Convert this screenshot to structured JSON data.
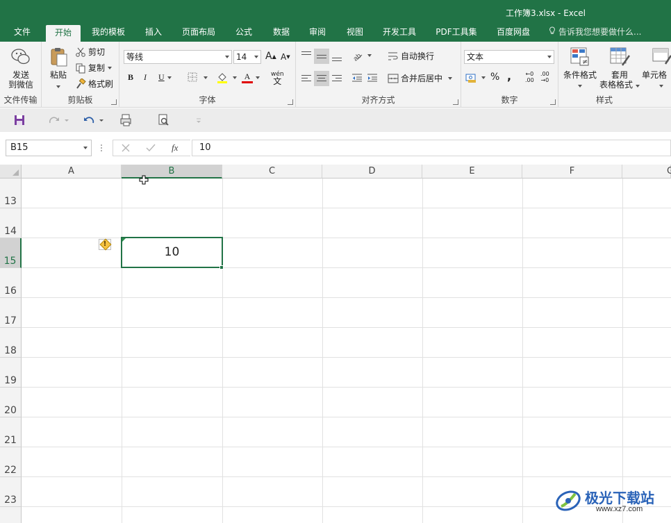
{
  "window": {
    "title": "工作簿3.xlsx - Excel"
  },
  "tabs": [
    {
      "label": "文件"
    },
    {
      "label": "开始"
    },
    {
      "label": "我的模板"
    },
    {
      "label": "插入"
    },
    {
      "label": "页面布局"
    },
    {
      "label": "公式"
    },
    {
      "label": "数据"
    },
    {
      "label": "审阅"
    },
    {
      "label": "视图"
    },
    {
      "label": "开发工具"
    },
    {
      "label": "PDF工具集"
    },
    {
      "label": "百度网盘"
    }
  ],
  "active_tab": "开始",
  "tell_me": "告诉我您想要做什么...",
  "ribbon": {
    "send": {
      "line1": "发送",
      "line2": "到微信",
      "group": "文件传输"
    },
    "clipboard": {
      "paste": "粘贴",
      "cut": "剪切",
      "copy": "复制",
      "format_painter": "格式刷",
      "group": "剪贴板"
    },
    "font": {
      "name": "等线",
      "size": "14",
      "bold": "B",
      "italic": "I",
      "underline": "U",
      "font_color_glyph": "A",
      "grow": "A",
      "shrink": "A",
      "wen": "wén",
      "wen_char": "文",
      "group": "字体"
    },
    "alignment": {
      "wrap": "自动换行",
      "merge": "合并后居中",
      "group": "对齐方式"
    },
    "number": {
      "format": "文本",
      "percent": "%",
      "comma": ",",
      "inc_decimal": ".00",
      "dec_decimal": ".00",
      "group": "数字"
    },
    "styles": {
      "conditional": "条件格式",
      "table_line1": "套用",
      "table_line2": "表格格式",
      "cell_styles": "单元格",
      "group": "样式"
    }
  },
  "formula_bar": {
    "name_box": "B15",
    "fx": "fx",
    "value": "10"
  },
  "grid": {
    "columns": [
      "A",
      "B",
      "C",
      "D",
      "E",
      "F",
      "G"
    ],
    "selected_column": "B",
    "rows": [
      "13",
      "14",
      "15",
      "16",
      "17",
      "18",
      "19",
      "20",
      "21",
      "22",
      "23"
    ],
    "selected_row": "15",
    "active_cell": {
      "ref": "B15",
      "value": "10"
    },
    "warning_glyph": "!"
  },
  "watermark": {
    "name": "极光下载站",
    "url": "www.xz7.com"
  },
  "colors": {
    "accent": "#217346",
    "warning": "#f6c341",
    "watermark": "#2a63b8"
  }
}
